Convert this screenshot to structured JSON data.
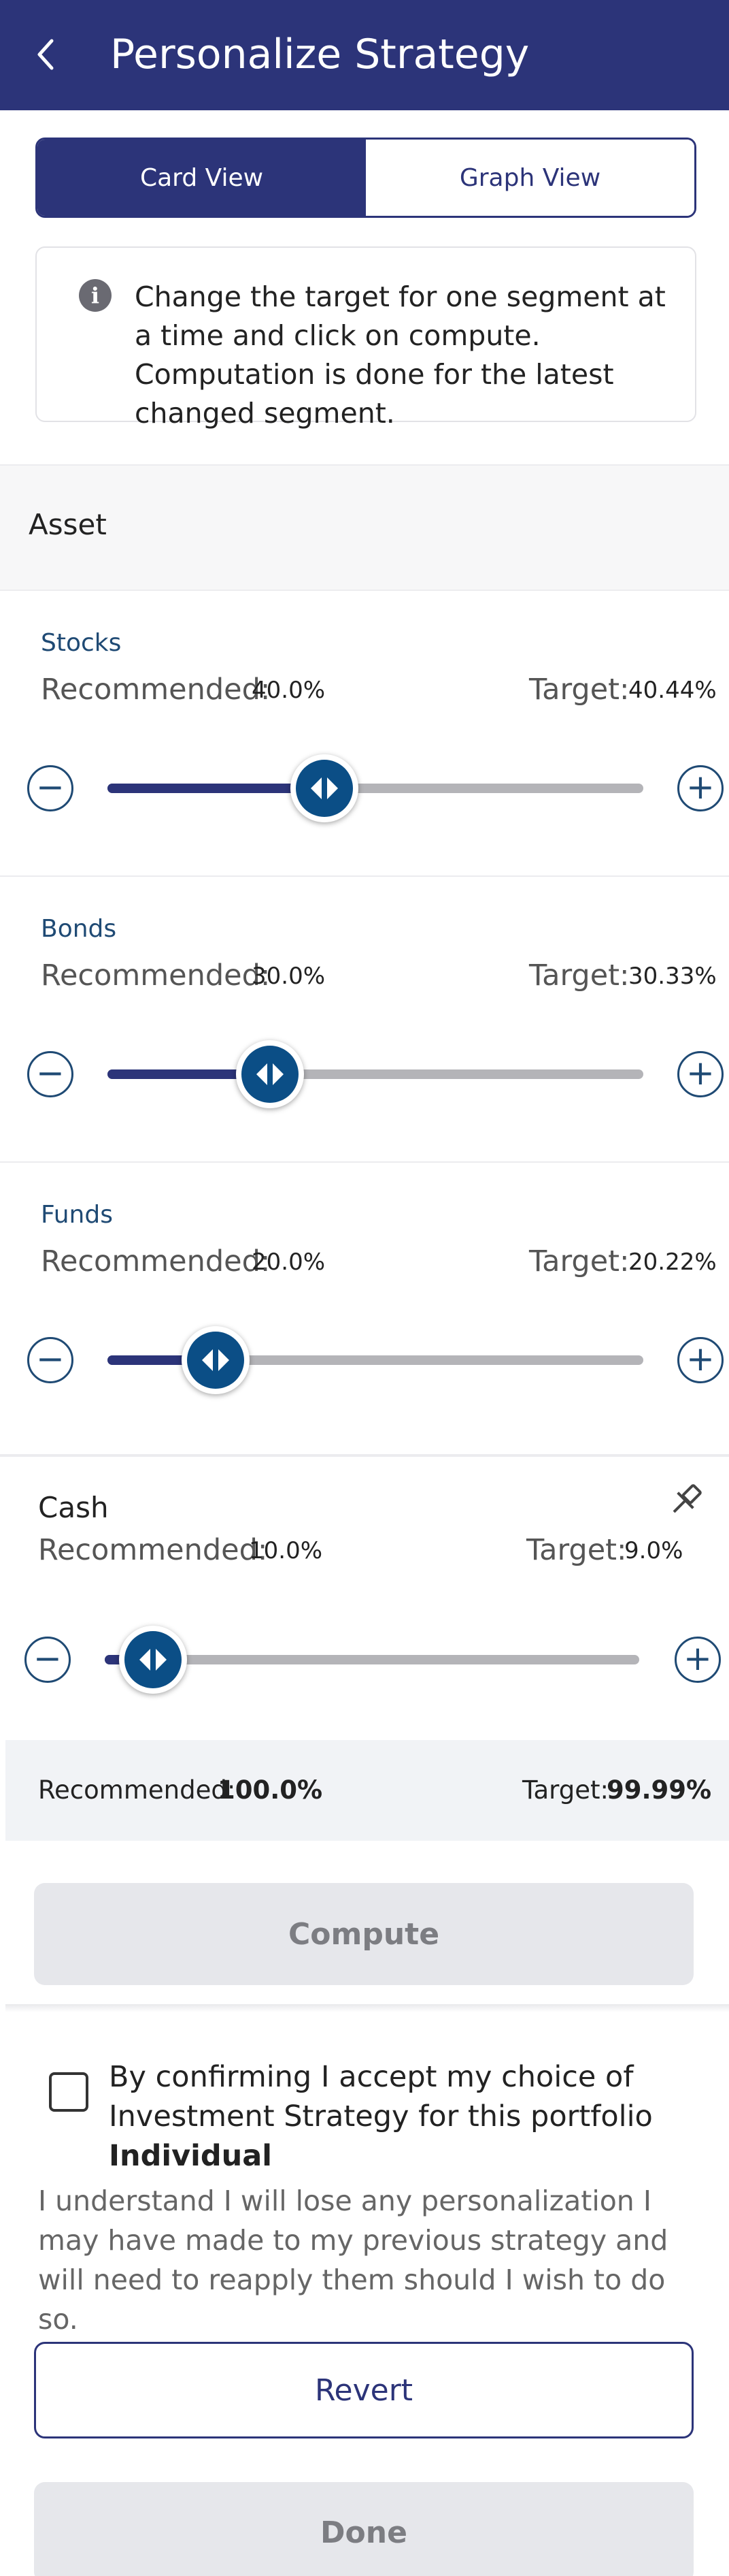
{
  "header": {
    "title": "Personalize Strategy"
  },
  "tabs": {
    "card": "Card View",
    "graph": "Graph View",
    "selected": "Card View"
  },
  "info": {
    "text": "Change the target for one segment at a time and click on compute. Computation is done for the latest changed segment."
  },
  "asset_section": {
    "label": "Asset"
  },
  "segments": [
    {
      "name": "Stocks",
      "recommended_label": "Recommended:",
      "recommended": "40.0%",
      "target_label": "Target:",
      "target": "40.44%",
      "slider_value_pct": 40.44
    },
    {
      "name": "Bonds",
      "recommended_label": "Recommended:",
      "recommended": "30.0%",
      "target_label": "Target:",
      "target": "30.33%",
      "slider_value_pct": 30.33
    },
    {
      "name": "Funds",
      "recommended_label": "Recommended:",
      "recommended": "20.0%",
      "target_label": "Target:",
      "target": "20.22%",
      "slider_value_pct": 20.22
    },
    {
      "name": "Cash",
      "recommended_label": "Recommended:",
      "recommended": "10.0%",
      "target_label": "Target:",
      "target": "9.0%",
      "slider_value_pct": 9.0,
      "pinned": true
    }
  ],
  "summary": {
    "recommended_label": "Recommended:",
    "recommended": "100.0%",
    "target_label": "Target:",
    "target": "99.99%"
  },
  "buttons": {
    "compute": "Compute",
    "revert": "Revert",
    "done": "Done"
  },
  "confirm": {
    "text_prefix": "By confirming I accept my choice of Investment Strategy for this portfolio ",
    "portfolio": "Individual",
    "checked": false
  },
  "note": "I understand I will lose any personalization I may have made to my previous strategy and will need to reapply them should I wish to do so.",
  "colors": {
    "primary": "#2c3479",
    "thumb": "#0b4e86",
    "segment_name": "#1f4a74",
    "track": "#b4b4b8",
    "disabled_bg": "#e6e7eb"
  },
  "icons": {
    "back": "chevron-left-icon",
    "info": "info-icon",
    "minus": "minus-circle-icon",
    "plus": "plus-circle-icon",
    "pin": "pin-icon",
    "thumb": "left-right-arrows-icon"
  }
}
